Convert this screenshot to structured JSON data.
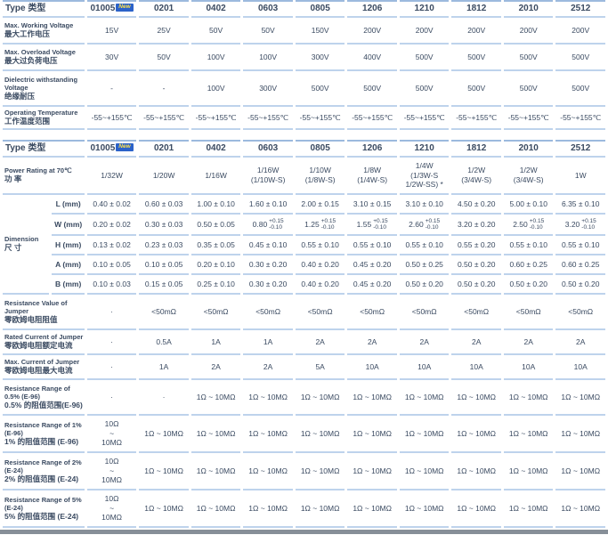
{
  "colors": {
    "text": "#3a4a61",
    "divider_line": "#bed3ec",
    "header_top_line": "#9cbade",
    "badge_bg": "#2b62c9",
    "badge_text": "#ffe14d",
    "bottom_bar": "#878f98"
  },
  "type_label": "Type 类型",
  "new_badge": "New",
  "columns": [
    "01005",
    "0201",
    "0402",
    "0603",
    "0805",
    "1206",
    "1210",
    "1812",
    "2010",
    "2512"
  ],
  "table1": {
    "rows": [
      {
        "label_en": "Max. Working Voltage",
        "label_zh": "最大工作电压",
        "values": [
          "15V",
          "25V",
          "50V",
          "50V",
          "150V",
          "200V",
          "200V",
          "200V",
          "200V",
          "200V"
        ]
      },
      {
        "label_en": "Max. Overload Voltage",
        "label_zh": "最大过负荷电压",
        "values": [
          "30V",
          "50V",
          "100V",
          "100V",
          "300V",
          "400V",
          "500V",
          "500V",
          "500V",
          "500V"
        ]
      },
      {
        "label_en": "Dielectric withstanding Voltage",
        "label_zh": "绝缘耐压",
        "values": [
          "-",
          "-",
          "100V",
          "300V",
          "500V",
          "500V",
          "500V",
          "500V",
          "500V",
          "500V"
        ]
      },
      {
        "label_en": "Operating Temperature",
        "label_zh": "工作温度范围",
        "values": [
          "-55~+155℃",
          "-55~+155℃",
          "-55~+155℃",
          "-55~+155℃",
          "-55~+155℃",
          "-55~+155℃",
          "-55~+155℃",
          "-55~+155℃",
          "-55~+155℃",
          "-55~+155℃"
        ]
      }
    ]
  },
  "table2": {
    "power": {
      "label_en": "Power Rating at 70℃",
      "label_zh": "功 率",
      "values": [
        "1/32W",
        "1/20W",
        "1/16W",
        "1/16W\n(1/10W-S)",
        "1/10W\n(1/8W-S)",
        "1/8W\n(1/4W-S)",
        "1/4W\n(1/3W-S\n1/2W-SS) *",
        "1/2W\n(3/4W-S)",
        "1/2W\n(3/4W-S)",
        "1W"
      ]
    },
    "dimension": {
      "label_en": "Dimension",
      "label_zh": "尺 寸",
      "rows": [
        {
          "sub": "L (mm)",
          "values": [
            "0.40 ± 0.02",
            "0.60 ± 0.03",
            "1.00 ± 0.10",
            "1.60 ± 0.10",
            "2.00 ± 0.15",
            "3.10 ± 0.15",
            "3.10 ± 0.10",
            "4.50 ± 0.20",
            "5.00 ± 0.10",
            "6.35 ± 0.10"
          ]
        },
        {
          "sub": "W (mm)",
          "values": [
            "0.20 ± 0.02",
            "0.30 ± 0.03",
            "0.50 ± 0.05",
            "0.80 +0.15/-0.10",
            "1.25 +0.15/-0.10",
            "1.55 +0.15/-0.10",
            "2.60 +0.15/-0.10",
            "3.20 ± 0.20",
            "2.50 +0.15/-0.10",
            "3.20 +0.15/-0.10"
          ]
        },
        {
          "sub": "H (mm)",
          "values": [
            "0.13 ± 0.02",
            "0.23 ± 0.03",
            "0.35 ± 0.05",
            "0.45 ± 0.10",
            "0.55 ± 0.10",
            "0.55 ± 0.10",
            "0.55 ± 0.10",
            "0.55 ± 0.20",
            "0.55 ± 0.10",
            "0.55 ± 0.10"
          ]
        },
        {
          "sub": "A (mm)",
          "values": [
            "0.10 ± 0.05",
            "0.10 ± 0.05",
            "0.20 ± 0.10",
            "0.30 ± 0.20",
            "0.40 ± 0.20",
            "0.45 ± 0.20",
            "0.50 ± 0.25",
            "0.50 ± 0.20",
            "0.60 ± 0.25",
            "0.60 ± 0.25"
          ]
        },
        {
          "sub": "B (mm)",
          "values": [
            "0.10 ± 0.03",
            "0.15 ± 0.05",
            "0.25 ± 0.10",
            "0.30 ± 0.20",
            "0.40 ± 0.20",
            "0.45 ± 0.20",
            "0.50 ± 0.20",
            "0.50 ± 0.20",
            "0.50 ± 0.20",
            "0.50 ± 0.20"
          ]
        }
      ]
    },
    "rows": [
      {
        "label_en": "Resistance Value of Jumper",
        "label_zh": "零欧姆电阻阻值",
        "values": [
          "·",
          "<50mΩ",
          "<50mΩ",
          "<50mΩ",
          "<50mΩ",
          "<50mΩ",
          "<50mΩ",
          "<50mΩ",
          "<50mΩ",
          "<50mΩ"
        ]
      },
      {
        "label_en": "Rated Current of Jumper",
        "label_zh": "零欧姆电阻额定电流",
        "values": [
          "·",
          "0.5A",
          "1A",
          "1A",
          "2A",
          "2A",
          "2A",
          "2A",
          "2A",
          "2A"
        ]
      },
      {
        "label_en": "Max. Current of Jumper",
        "label_zh": "零欧姆电阻最大电流",
        "values": [
          "·",
          "1A",
          "2A",
          "2A",
          "5A",
          "10A",
          "10A",
          "10A",
          "10A",
          "10A"
        ]
      },
      {
        "label_en": "Resistance Range of 0.5% (E-96)",
        "label_zh": "0.5% 的阻值范围(E-96)",
        "values": [
          "·",
          "·",
          "1Ω ~ 10MΩ",
          "1Ω ~ 10MΩ",
          "1Ω ~ 10MΩ",
          "1Ω ~ 10MΩ",
          "1Ω ~ 10MΩ",
          "1Ω ~ 10MΩ",
          "1Ω ~ 10MΩ",
          "1Ω ~ 10MΩ"
        ]
      },
      {
        "label_en": "Resistance Range of 1% (E-96)",
        "label_zh": "1% 的阻值范围 (E-96)",
        "values": [
          "10Ω\n~\n10MΩ",
          "1Ω ~ 10MΩ",
          "1Ω ~ 10MΩ",
          "1Ω ~ 10MΩ",
          "1Ω ~ 10MΩ",
          "1Ω ~ 10MΩ",
          "1Ω ~ 10MΩ",
          "1Ω ~ 10MΩ",
          "1Ω ~ 10MΩ",
          "1Ω ~ 10MΩ"
        ]
      },
      {
        "label_en": "Resistance Range of 2% (E-24)",
        "label_zh": "2% 的阻值范围 (E-24)",
        "values": [
          "10Ω\n~\n10MΩ",
          "1Ω ~ 10MΩ",
          "1Ω ~ 10MΩ",
          "1Ω ~ 10MΩ",
          "1Ω ~ 10MΩ",
          "1Ω ~ 10MΩ",
          "1Ω ~ 10MΩ",
          "1Ω ~ 10MΩ",
          "1Ω ~ 10MΩ",
          "1Ω ~ 10MΩ"
        ]
      },
      {
        "label_en": "Resistance Range of 5% (E-24)",
        "label_zh": "5% 的阻值范围 (E-24)",
        "values": [
          "10Ω\n~\n10MΩ",
          "1Ω ~ 10MΩ",
          "1Ω ~ 10MΩ",
          "1Ω ~ 10MΩ",
          "1Ω ~ 10MΩ",
          "1Ω ~ 10MΩ",
          "1Ω ~ 10MΩ",
          "1Ω ~ 10MΩ",
          "1Ω ~ 10MΩ",
          "1Ω ~ 10MΩ"
        ]
      }
    ]
  }
}
